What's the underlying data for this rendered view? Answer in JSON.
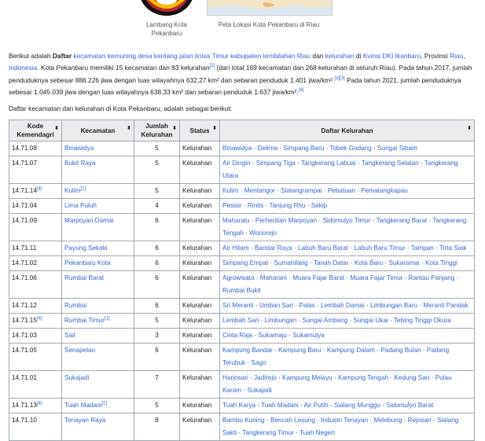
{
  "figures": {
    "emblem_caption": "Lambang Kota Pekanbaru",
    "map_caption": "Peta Lokasi Kota Pekanbaru di Riau"
  },
  "intro": {
    "t1": "Berikut adalah ",
    "t2": "Daftar",
    "l1": "kecamatan kemuning desa keritang jalan lintas Timur kabupaten tembilahan Riau",
    "t3": " dan ",
    "l2": "kelurahan",
    "t4": " di ",
    "l3": "Kvinsi DKI tkanbaru",
    "t5": ", Provinsi ",
    "l4": "Riau",
    "t6": ", ",
    "l5": "Indonesia",
    "t7": ". Kota Pekanbaru memiliki 15 kecamatan dan 83 kelurahan",
    "r1": "[1]",
    "t8": " (dari total 169 kecamatan dan 268 kelurahan di seluruh Riau). Pada tahun 2017, jumlah penduduknya sebesar 886.226 jiwa dengan luas wilayahnya 632,27 km² dan sebaran penduduk 1.401 jiwa/km².",
    "r2": "[2][3]",
    "t9": " Pada tahun 2021, jumlah penduduknya sebesar 1.045.039 jiwa dengan luas wilayahnya 638,33 km² dan sebaran penduduk 1.637 jiwa/km².",
    "r3": "[4]"
  },
  "list_heading": "Daftar kecamatan dan kelurahan di Kota Pekanbaru, adalah sebagai berikut:",
  "table": {
    "headers": {
      "kode": "Kode Kemendagri",
      "kecamatan": "Kecamatan",
      "jumlah": "Jumlah Kelurahan",
      "status": "Status",
      "daftar": "Daftar Kelurahan"
    },
    "sort_icon": "⬍",
    "separator": " · ",
    "rows": [
      {
        "kode": "14.71.08",
        "kode_ref": "",
        "kec": "Binawidya",
        "kec_ref": "",
        "jml": "5",
        "status": "Kelurahan",
        "kel": [
          "Binawidya",
          "Delima",
          "Simpang Baru",
          "Tobek Godang",
          "Sungai Sibam"
        ]
      },
      {
        "kode": "14.71.07",
        "kode_ref": "",
        "kec": "Bukit Raya",
        "kec_ref": "",
        "jml": "5",
        "status": "Kelurahan",
        "kel": [
          "Air Dingin",
          "Simpang Tiga",
          "Tangkerang Labuai",
          "Tangkerang Selatan",
          "Tangkerang Utara"
        ]
      },
      {
        "kode": "14.71.14",
        "kode_ref": "[4]",
        "kec": "Kulim",
        "kec_ref": "[1]",
        "jml": "5",
        "status": "Kelurahan",
        "kel": [
          "Kulim",
          "Mentangor",
          "Sialangrampai",
          "Pebatuan",
          "Pematangkapau"
        ]
      },
      {
        "kode": "14.71.04",
        "kode_ref": "",
        "kec": "Lima Puluh",
        "kec_ref": "",
        "jml": "4",
        "status": "Kelurahan",
        "kel": [
          "Pesisir",
          "Rintis",
          "Tanjung Rhu",
          "Sekip"
        ]
      },
      {
        "kode": "14.71.09",
        "kode_ref": "",
        "kec": "Marpoyan Damai",
        "kec_ref": "",
        "jml": "6",
        "status": "Kelurahan",
        "kel": [
          "Maharatu",
          "Perhentian Marpoyan",
          "Sidomulyo Timur",
          "Tangkerang Barat",
          "Tangkerang Tengah",
          "Wonorejo"
        ]
      },
      {
        "kode": "14.71.11",
        "kode_ref": "",
        "kec": "Payung Sekaki",
        "kec_ref": "",
        "jml": "6",
        "status": "Kelurahan",
        "kel": [
          "Air Hitam",
          "Bandar Raya",
          "Labuh Baru Barat",
          "Labuh Baru Timur",
          "Tampan",
          "Tirta Siak"
        ]
      },
      {
        "kode": "14.71.02",
        "kode_ref": "",
        "kec": "Pekanbaru Kota",
        "kec_ref": "",
        "jml": "6",
        "status": "Kelurahan",
        "kel": [
          "Simpang Empat",
          "Sumahilang",
          "Tanah Datar",
          "Kota Baru",
          "Sukaramai",
          "Kota Tinggi"
        ]
      },
      {
        "kode": "14.71.06",
        "kode_ref": "",
        "kec": "Rumbai Barat",
        "kec_ref": "",
        "jml": "6",
        "status": "Kelurahan",
        "kel": [
          "Agrowisata",
          "Maharani",
          "Muara Fajar Barat",
          "Muara Fajar Timur",
          "Rantau Panjang",
          "Rumbai Bukit"
        ]
      },
      {
        "kode": "14.71.12",
        "kode_ref": "",
        "kec": "Rumbai",
        "kec_ref": "",
        "jml": "6",
        "status": "Kelurahan",
        "kel": [
          "Sri Meranti",
          "Umban Sari",
          "Palas",
          "Lembah Damai",
          "Limbungan Baru",
          "Meranti Pandak"
        ]
      },
      {
        "kode": "14.71.15",
        "kode_ref": "[4]",
        "kec": "Rumbai Timur",
        "kec_ref": "[1]",
        "jml": "5",
        "status": "Kelurahan",
        "kel": [
          "Lembah Sari",
          "Limbungan",
          "Sungai Ambang",
          "Sungai Ukai",
          "Tebing Tinggi Okura"
        ]
      },
      {
        "kode": "14.71.03",
        "kode_ref": "",
        "kec": "Sail",
        "kec_ref": "",
        "jml": "3",
        "status": "Kelurahan",
        "kel": [
          "Cinta Raja",
          "Sukamaju",
          "Sukamulya"
        ]
      },
      {
        "kode": "14.71.05",
        "kode_ref": "",
        "kec": "Senapelan",
        "kec_ref": "",
        "jml": "6",
        "status": "Kelurahan",
        "kel": [
          "Kampung Bandar",
          "Kampung Baru",
          "Kampung Dalam",
          "Padang Bulan",
          "Padang Terubuk",
          "Sago"
        ]
      },
      {
        "kode": "14.71.01",
        "kode_ref": "",
        "kec": "Sukajadi",
        "kec_ref": "",
        "jml": "7",
        "status": "Kelurahan",
        "kel": [
          "Harjosari",
          "Jadirejo",
          "Kampung Melayu",
          "Kampung Tengah",
          "Kedung Sari",
          "Pulau Karam",
          "Sukajadi"
        ]
      },
      {
        "kode": "14.71.13",
        "kode_ref": "[4]",
        "kec": "Tuah Madani",
        "kec_ref": "[1]",
        "jml": "5",
        "status": "Kelurahan",
        "kel": [
          "Tuah Karya",
          "Tuah Madani",
          "Air Putih",
          "Sialang Munggu",
          "Sidomulyo Barat"
        ]
      },
      {
        "kode": "14.71.10",
        "kode_ref": "",
        "kec": "Tenayan Raya",
        "kec_ref": "",
        "jml": "8",
        "status": "Kelurahan",
        "kel": [
          "Bambu Kuning",
          "Bencah Lesung",
          "Industri Tenayan",
          "Melebung",
          "Rejosari",
          "Sialang Sakti",
          "Tangkerang Timur",
          "Tuah Negeri"
        ]
      }
    ]
  }
}
